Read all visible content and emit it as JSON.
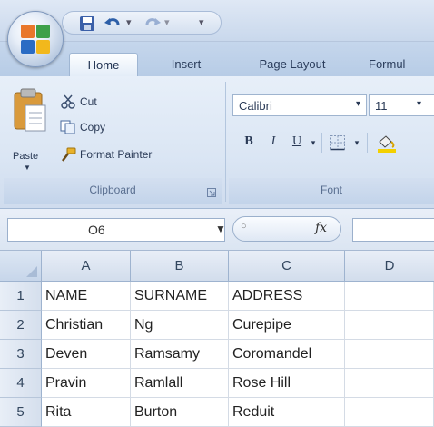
{
  "quick_access": {
    "save_icon": "save-icon",
    "undo_icon": "undo-icon",
    "redo_icon": "redo-icon",
    "customize_icon": "customize-qat-icon"
  },
  "tabs": [
    {
      "label": "Home",
      "active": true
    },
    {
      "label": "Insert",
      "active": false
    },
    {
      "label": "Page Layout",
      "active": false
    },
    {
      "label": "Formul",
      "active": false
    }
  ],
  "clipboard": {
    "paste_label": "Paste",
    "cut_label": "Cut",
    "copy_label": "Copy",
    "format_painter_label": "Format Painter",
    "group_label": "Clipboard"
  },
  "font": {
    "font_name": "Calibri",
    "font_size": "11",
    "bold_label": "B",
    "italic_label": "I",
    "underline_label": "U",
    "group_label": "Font"
  },
  "formula_bar": {
    "name_box": "O6",
    "fx_label": "fx"
  },
  "columns": [
    "A",
    "B",
    "C",
    "D"
  ],
  "rows": [
    {
      "num": "1",
      "cells": [
        "NAME",
        "SURNAME",
        "ADDRESS",
        ""
      ]
    },
    {
      "num": "2",
      "cells": [
        "Christian",
        "Ng",
        "Curepipe",
        ""
      ]
    },
    {
      "num": "3",
      "cells": [
        "Deven",
        "Ramsamy",
        "Coromandel",
        ""
      ]
    },
    {
      "num": "4",
      "cells": [
        "Pravin",
        "Ramlall",
        "Rose Hill",
        ""
      ]
    },
    {
      "num": "5",
      "cells": [
        "Rita",
        "Burton",
        "Reduit",
        ""
      ]
    }
  ],
  "colors": {
    "ribbon": "#dbe6f4",
    "header": "#d2ddec",
    "office_orange": "#e9772b",
    "office_green": "#3ea04a",
    "office_blue": "#2b6cc4"
  }
}
